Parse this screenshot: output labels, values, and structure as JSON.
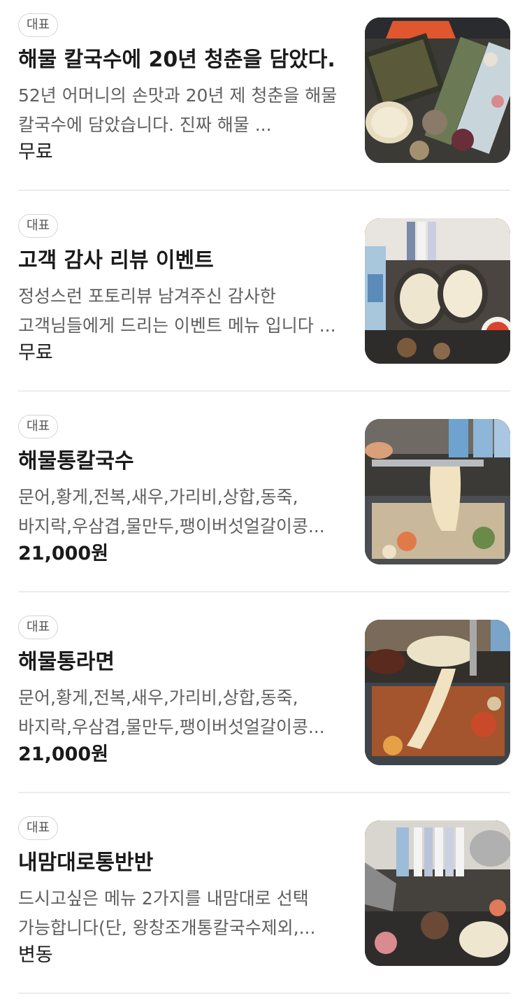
{
  "menu": {
    "items": [
      {
        "badge": "대표",
        "name": "해물 칼국수에 20년 청춘을 담았다.",
        "description": "52년 어머니의 손맛과 20년 제 청춘을 해물 칼국수에 담았습니다. 진짜 해물 ...",
        "price": "무료"
      },
      {
        "badge": "대표",
        "name": "고객 감사 리뷰 이벤트",
        "description": "정성스런 포토리뷰 남겨주신 감사한 고객님들에게 드리는 이벤트 메뉴 입니다 ...",
        "price": "무료"
      },
      {
        "badge": "대표",
        "name": "해물통칼국수",
        "description": "문어,황게,전복,새우,가리비,상합,동죽,바지락,우삼겹,물만두,팽이버섯얼갈이콩...",
        "price": "21,000원"
      },
      {
        "badge": "대표",
        "name": "해물통라면",
        "description": "문어,황게,전복,새우,가리비,상합,동죽,바지락,우삼겹,물만두,팽이버섯얼갈이콩...",
        "price": "21,000원"
      },
      {
        "badge": "대표",
        "name": "내맘대로통반반",
        "description": "드시고싶은 메뉴 2가지를 내맘대로 선택 가능합니다(단, 왕창조개통칼국수제외,...",
        "price": "변동"
      }
    ]
  }
}
